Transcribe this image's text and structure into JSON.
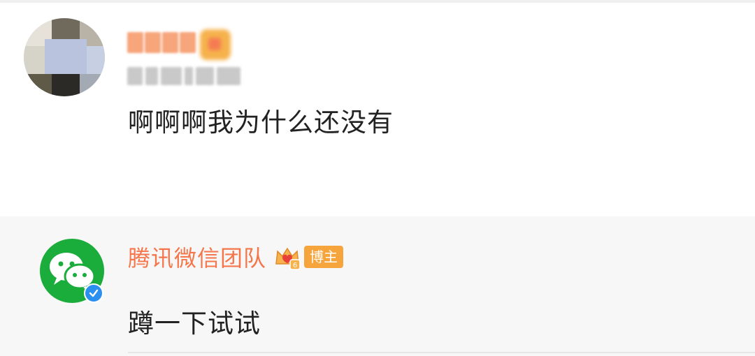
{
  "comment": {
    "text": "啊啊啊我为什么还没有"
  },
  "reply": {
    "author_name": "腾讯微信团队",
    "author_role_badge": "博主",
    "crown_level": "6",
    "text": "蹲一下试试"
  },
  "icons": {
    "commenter_avatar": "blurred-avatar",
    "commenter_crown": "blurred-crown-icon",
    "reply_avatar": "wechat-logo-icon",
    "verified": "verified-check-icon",
    "member_crown": "crown-icon"
  },
  "colors": {
    "author_name": "#f4764a",
    "blogger_badge_bg": "#f6a43c",
    "wechat_green": "#1aad3b",
    "verified_blue": "#2b8ff0",
    "reply_bg": "#f7f7f7",
    "body_text": "#222222"
  }
}
